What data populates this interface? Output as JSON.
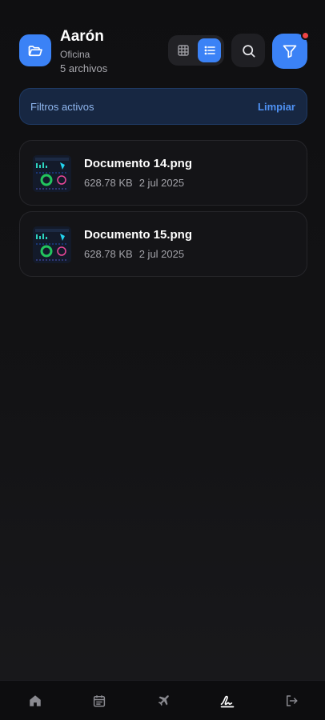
{
  "header": {
    "name": "Aarón",
    "location": "Oficina",
    "file_count": "5 archivos",
    "icons": {
      "folder": "folder-open-icon",
      "grid_view": "grid-view-icon",
      "list_view": "list-view-icon",
      "search": "search-icon",
      "filter": "filter-icon"
    },
    "active_view": "list"
  },
  "filters": {
    "label": "Filtros activos",
    "clear_label": "Limpiar"
  },
  "files": [
    {
      "name": "Documento 14.png",
      "size": "628.78 KB",
      "date": "2 jul 2025"
    },
    {
      "name": "Documento 15.png",
      "size": "628.78 KB",
      "date": "2 jul 2025"
    }
  ],
  "bottom_nav": {
    "items": [
      "home-icon",
      "calendar-icon",
      "plane-icon",
      "signature-icon",
      "logout-icon"
    ],
    "active": "signature-icon"
  },
  "colors": {
    "accent": "#3b82f6",
    "badge": "#ef4444",
    "background": "#131315"
  }
}
